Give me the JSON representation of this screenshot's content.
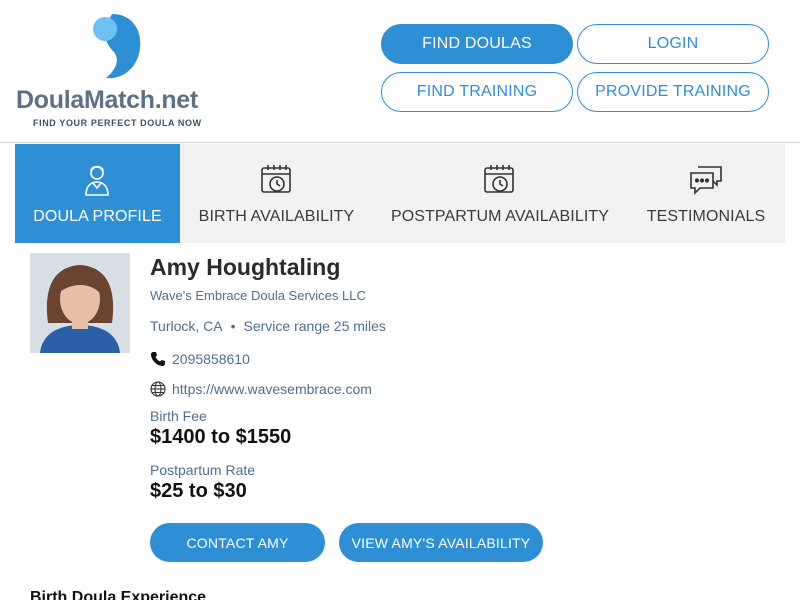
{
  "logo": {
    "name_part1": "DoulaMatch",
    "name_part2": ".net",
    "tagline": "FIND YOUR PERFECT DOULA NOW"
  },
  "nav": {
    "find_doulas": "FIND DOULAS",
    "login": "LOGIN",
    "find_training": "FIND TRAINING",
    "provide_training": "PROVIDE TRAINING"
  },
  "tabs": [
    {
      "label": "DOULA PROFILE",
      "icon": "doula-person-icon",
      "active": true
    },
    {
      "label": "BIRTH AVAILABILITY",
      "icon": "calendar-clock-icon",
      "active": false
    },
    {
      "label": "POSTPARTUM AVAILABILITY",
      "icon": "calendar-clock-icon",
      "active": false
    },
    {
      "label": "TESTIMONIALS",
      "icon": "chat-bubbles-icon",
      "active": false
    }
  ],
  "profile": {
    "name": "Amy Houghtaling",
    "business": "Wave's Embrace Doula Services LLC",
    "city": "Turlock, CA",
    "service_range": "Service range 25 miles",
    "phone": "2095858610",
    "website": "https://www.wavesembrace.com",
    "birth_fee_label": "Birth Fee",
    "birth_fee": "$1400 to $1550",
    "postpartum_label": "Postpartum Rate",
    "postpartum_rate": "$25 to $30",
    "contact_button": "CONTACT AMY",
    "availability_button": "VIEW AMY'S AVAILABILITY"
  },
  "section": {
    "experience_title": "Birth Doula Experience"
  },
  "colors": {
    "accent": "#2f8fd5",
    "tab_bg": "#f2f2f2",
    "muted_text": "#4f6f8e"
  }
}
